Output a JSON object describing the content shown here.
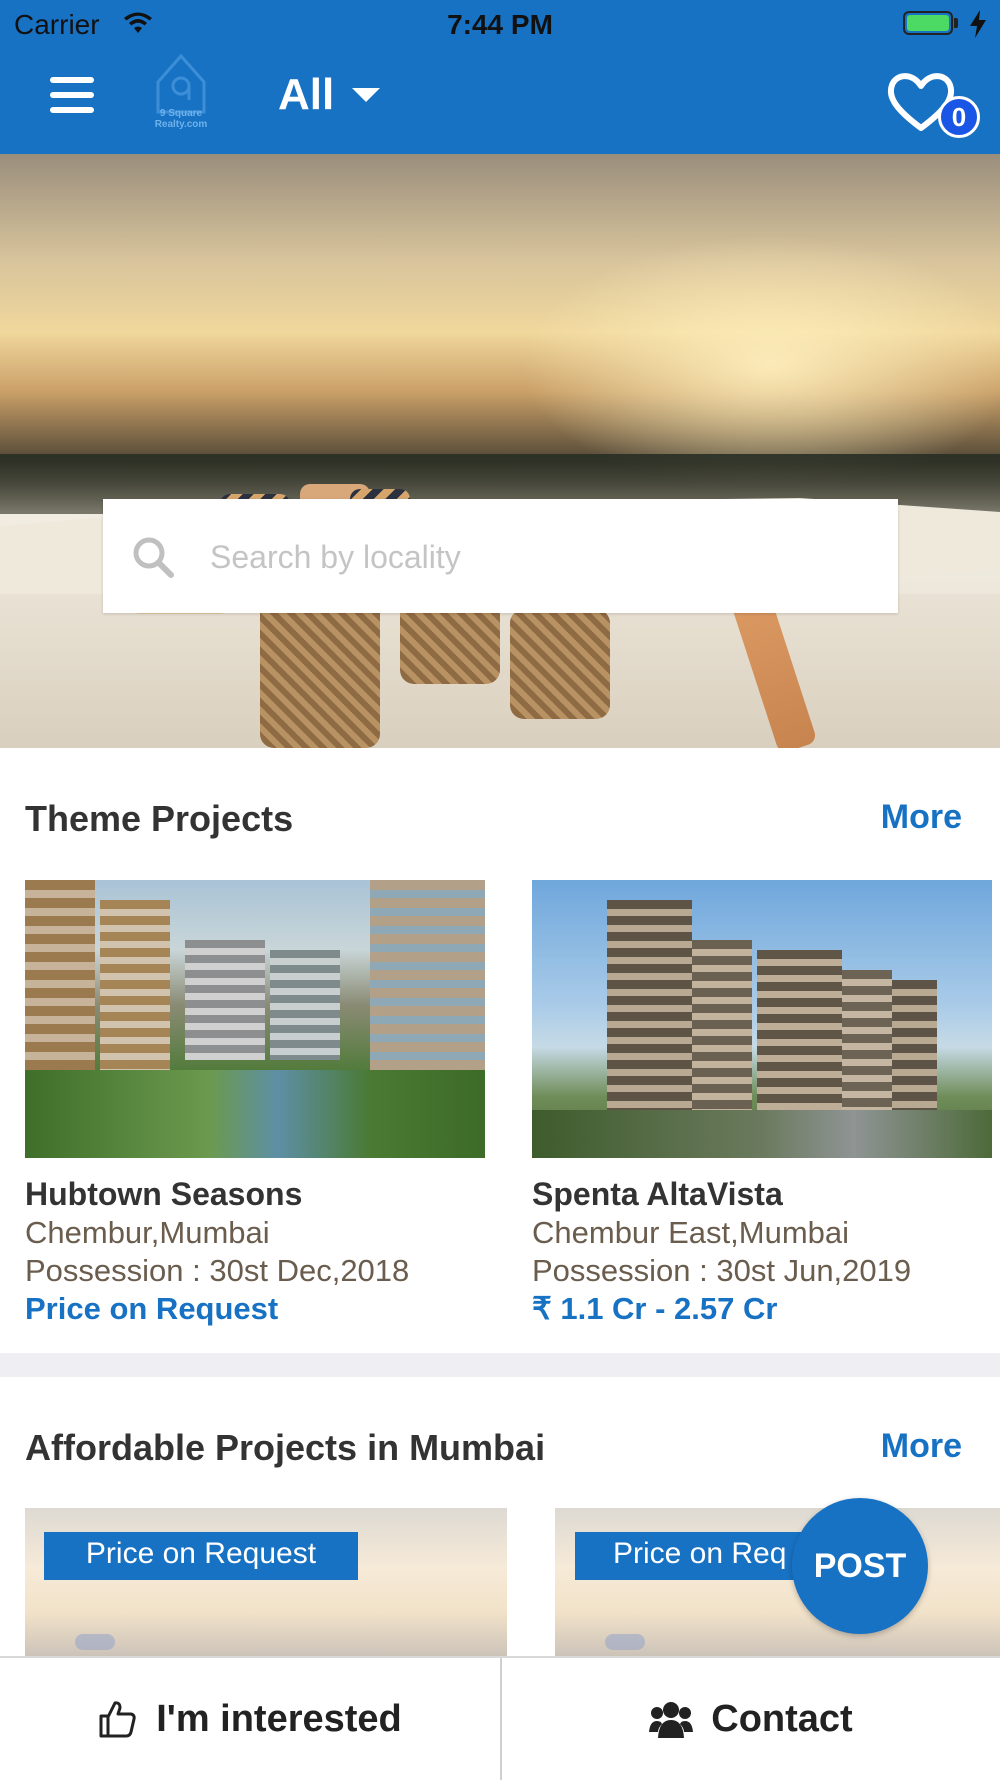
{
  "status_bar": {
    "carrier": "Carrier",
    "time": "7:44 PM"
  },
  "navbar": {
    "logo_text": "9 Square Realty.com",
    "filter_label": "All",
    "favorites_count": "0"
  },
  "search": {
    "placeholder": "Search by locality"
  },
  "theme_projects": {
    "title": "Theme Projects",
    "more_label": "More",
    "cards": [
      {
        "name": "Hubtown Seasons",
        "location": "Chembur,Mumbai",
        "possession": "Possession : 30st Dec,2018",
        "price": "Price on Request"
      },
      {
        "name": "Spenta AltaVista",
        "location": "Chembur East,Mumbai",
        "possession": "Possession : 30st Jun,2019",
        "price": "₹ 1.1 Cr - 2.57 Cr"
      }
    ]
  },
  "affordable_projects": {
    "title": "Affordable Projects in Mumbai",
    "more_label": "More",
    "cards": [
      {
        "tag": "Price on Request"
      },
      {
        "tag": "Price on Req"
      }
    ]
  },
  "fab": {
    "label": "POST"
  },
  "bottom_bar": {
    "interested_label": "I'm interested",
    "contact_label": "Contact"
  },
  "icons": [
    "wifi-icon",
    "battery-icon",
    "menu-icon",
    "logo",
    "caret-down-icon",
    "heart-icon",
    "search-icon",
    "thumbs-up-icon",
    "group-icon"
  ],
  "colors": {
    "primary": "#1872c4",
    "badge": "#1a56e6",
    "text": "#333333",
    "secondary_text": "#6a5d4e"
  }
}
